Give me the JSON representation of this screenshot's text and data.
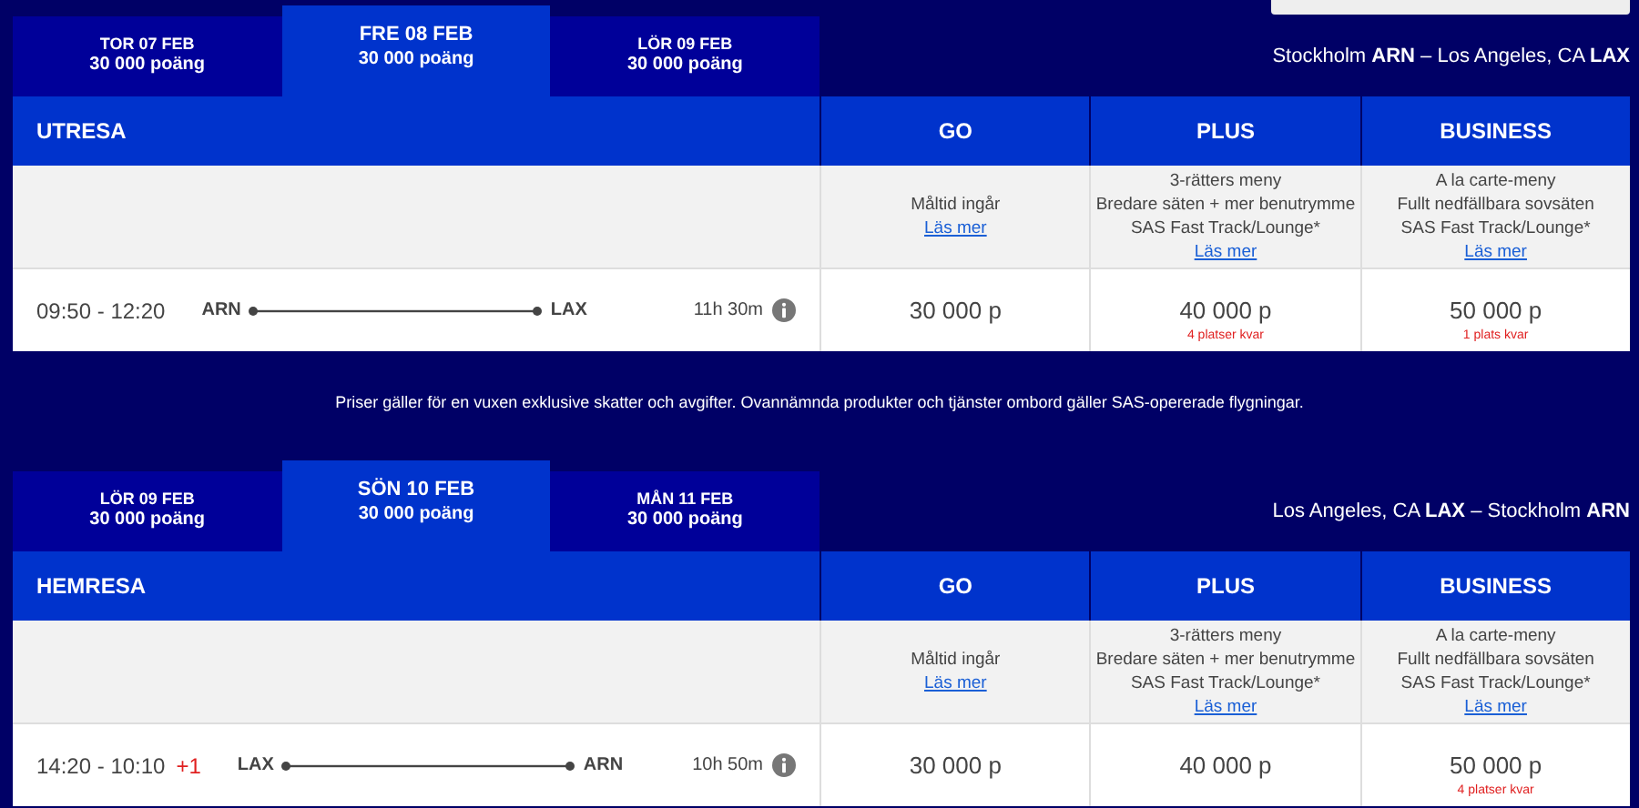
{
  "journeys": [
    {
      "tabs": [
        {
          "day": "TOR 07 FEB",
          "points": "30 000 poäng",
          "selected": false
        },
        {
          "day": "FRE 08 FEB",
          "points": "30 000 poäng",
          "selected": true
        },
        {
          "day": "LÖR 09 FEB",
          "points": "30 000 poäng",
          "selected": false
        }
      ],
      "route": "Stockholm **ARN** – Los Angeles, CA **LAX**",
      "title": "UTRESA",
      "classes": [
        {
          "name": "GO",
          "features": [
            "Måltid ingår"
          ],
          "link": "Läs mer"
        },
        {
          "name": "PLUS",
          "features": [
            "3-rätters meny",
            "Bredare säten + mer benutrymme",
            "SAS Fast Track/Lounge*"
          ],
          "link": "Läs mer"
        },
        {
          "name": "BUSINESS",
          "features": [
            "A la carte-meny",
            "Fullt nedfällbara sovsäten",
            "SAS Fast Track/Lounge*"
          ],
          "link": "Läs mer"
        }
      ],
      "flight": {
        "times": "09:50 - 12:20",
        "from": "ARN",
        "to": "LAX",
        "duration": "11h 30m"
      },
      "prices": [
        {
          "price": "30 000 p"
        },
        {
          "price": "40 000 p",
          "seats": "4 platser kvar"
        },
        {
          "price": "50 000 p",
          "seats": "1 plats kvar"
        }
      ]
    },
    {
      "tabs": [
        {
          "day": "LÖR 09 FEB",
          "points": "30 000 poäng",
          "selected": false
        },
        {
          "day": "SÖN 10 FEB",
          "points": "30 000 poäng",
          "selected": true
        },
        {
          "day": "MÅN 11 FEB",
          "points": "30 000 poäng",
          "selected": false
        }
      ],
      "route": "Los Angeles, CA **LAX** – Stockholm **ARN**",
      "title": "HEMRESA",
      "classes": [
        {
          "name": "GO",
          "features": [
            "Måltid ingår"
          ],
          "link": "Läs mer"
        },
        {
          "name": "PLUS",
          "features": [
            "3-rätters meny",
            "Bredare säten + mer benutrymme",
            "SAS Fast Track/Lounge*"
          ],
          "link": "Läs mer"
        },
        {
          "name": "BUSINESS",
          "features": [
            "A la carte-meny",
            "Fullt nedfällbara sovsäten",
            "SAS Fast Track/Lounge*"
          ],
          "link": "Läs mer"
        }
      ],
      "flight": {
        "times": "14:20 - 10:10",
        "day_offset": "+1",
        "from": "LAX",
        "to": "ARN",
        "duration": "10h 50m"
      },
      "prices": [
        {
          "price": "30 000 p"
        },
        {
          "price": "40 000 p"
        },
        {
          "price": "50 000 p",
          "seats": "4 platser kvar"
        }
      ]
    }
  ],
  "footnote": "Priser gäller för en vuxen exklusive skatter och avgifter. Ovannämnda produkter och tjänster ombord gäller SAS-opererade flygningar."
}
